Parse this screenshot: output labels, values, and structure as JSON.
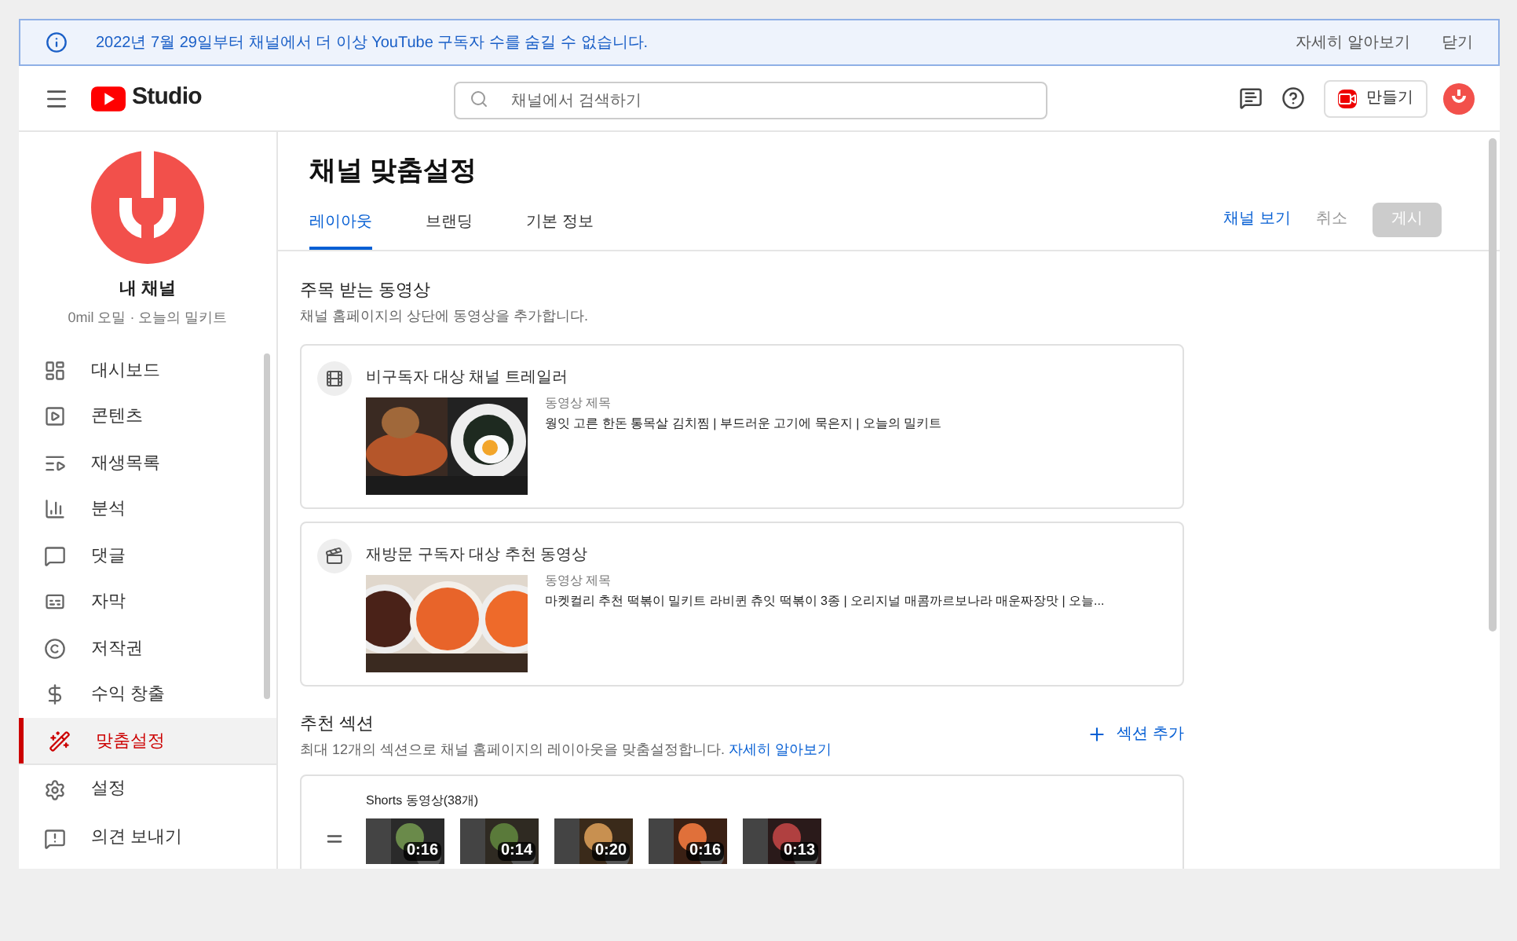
{
  "banner": {
    "message": "2022년 7월 29일부터 채널에서 더 이상 YouTube 구독자 수를 숨길 수 없습니다.",
    "learn_more": "자세히 알아보기",
    "close": "닫기"
  },
  "header": {
    "logo_text": "Studio",
    "search": {
      "placeholder": "채널에서 검색하기"
    },
    "create_button": "만들기"
  },
  "sidebar": {
    "channel_name": "내 채널",
    "channel_subtitle": "0mil 오밀 · 오늘의 밀키트",
    "items": [
      {
        "label": "대시보드",
        "selected": false
      },
      {
        "label": "콘텐츠",
        "selected": false
      },
      {
        "label": "재생목록",
        "selected": false
      },
      {
        "label": "분석",
        "selected": false
      },
      {
        "label": "댓글",
        "selected": false
      },
      {
        "label": "자막",
        "selected": false
      },
      {
        "label": "저작권",
        "selected": false
      },
      {
        "label": "수익 창출",
        "selected": false
      },
      {
        "label": "맞춤설정",
        "selected": true
      }
    ],
    "bottom_items": [
      {
        "label": "설정"
      },
      {
        "label": "의견 보내기"
      }
    ]
  },
  "page": {
    "title": "채널 맞춤설정",
    "tabs": [
      {
        "label": "레이아웃",
        "selected": true
      },
      {
        "label": "브랜딩",
        "selected": false
      },
      {
        "label": "기본 정보",
        "selected": false
      }
    ],
    "actions": {
      "view_channel": "채널 보기",
      "cancel": "취소",
      "publish": "게시",
      "publish_disabled": true
    },
    "featured": {
      "title": "주목 받는 동영상",
      "subtitle": "채널 홈페이지의 상단에 동영상을 추가합니다.",
      "cards": [
        {
          "title": "비구독자 대상 채널 트레일러",
          "video_label": "동영상 제목",
          "video_title": "웡잇 고른 한돈 통목살 김치찜 | 부드러운 고기에 묵은지 | 오늘의 밀키트"
        },
        {
          "title": "재방문 구독자 대상 추천 동영상",
          "video_label": "동영상 제목",
          "video_title": "마켓컬리 추천 떡볶이 밀키트 라비퀸 츄잇 떡볶이 3종 | 오리지널 매콤까르보나라 매운짜장맛 | 오늘..."
        }
      ]
    },
    "sections": {
      "title": "추천 섹션",
      "subtitle": "최대 12개의 섹션으로 채널 홈페이지의 레이아웃을 맞춤설정합니다.",
      "link": "자세히 알아보기",
      "add_button": "섹션 추가",
      "shorts": {
        "title": "Shorts 동영상(38개)",
        "durations": [
          "0:16",
          "0:14",
          "0:20",
          "0:16",
          "0:13"
        ]
      }
    }
  }
}
